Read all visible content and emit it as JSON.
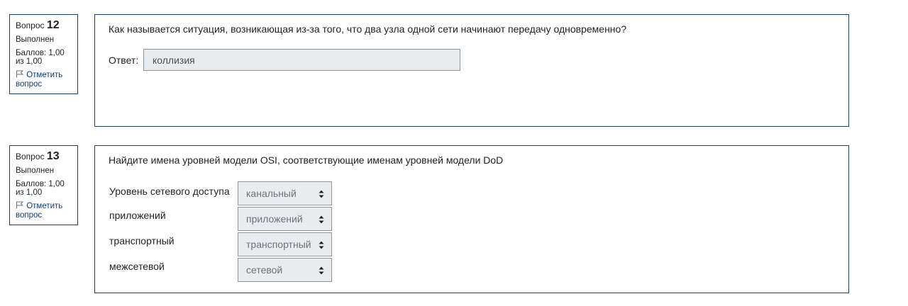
{
  "questions": [
    {
      "label": "Вопрос",
      "number": "12",
      "state": "Выполнен",
      "grade": "Баллов: 1,00 из 1,00",
      "flag_label": "Отметить вопрос",
      "text": "Как называется ситуация, возникающая из-за того, что два узла одной сети  начинают передачу одновременно?",
      "answer_label": "Ответ:",
      "answer_value": "коллизия"
    },
    {
      "label": "Вопрос",
      "number": "13",
      "state": "Выполнен",
      "grade": "Баллов: 1,00 из 1,00",
      "flag_label": "Отметить вопрос",
      "text": "Найдите имена уровней модели OSI, соответствующие именам уровней модели DoD",
      "matches": [
        {
          "label": "Уровень сетевого доступа",
          "selected": "канальный"
        },
        {
          "label": "приложений",
          "selected": "приложений"
        },
        {
          "label": "транспортный",
          "selected": "транспортный"
        },
        {
          "label": "межсетевой",
          "selected": "сетевой"
        }
      ]
    }
  ],
  "colors": {
    "border": "#1b3f6e",
    "field_bg": "#e9ecef",
    "link": "#0f3e7a"
  },
  "icons": {
    "flag": "flag-icon",
    "select_caret": "sort-caret-icon"
  }
}
